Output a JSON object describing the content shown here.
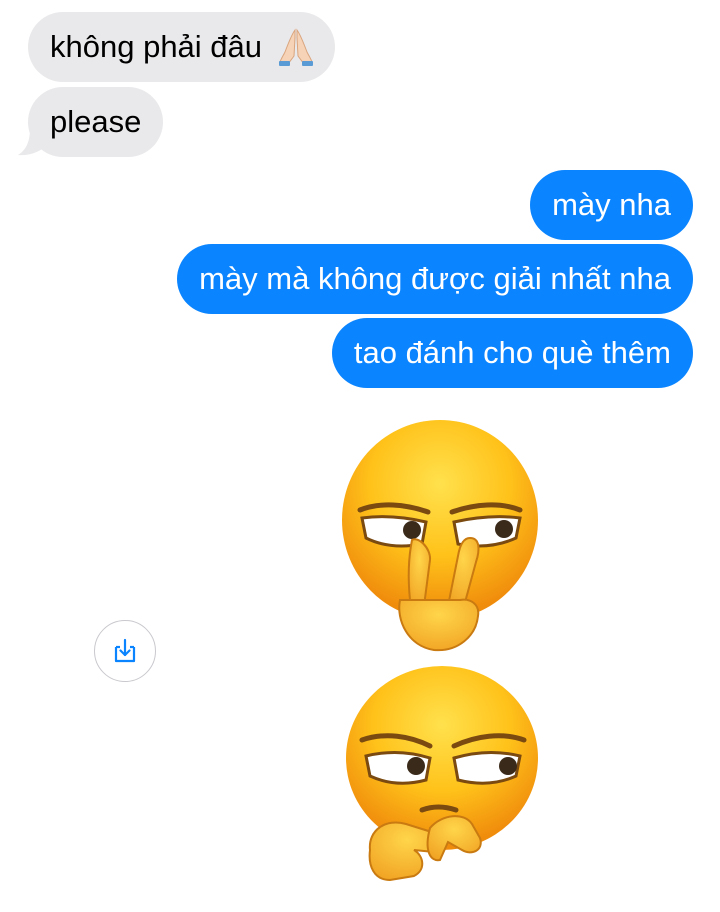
{
  "incoming_messages": [
    {
      "text": "không phải đâu",
      "emoji": "folded-hands"
    },
    {
      "text": "please"
    }
  ],
  "outgoing_messages": [
    {
      "text": "mày nha"
    },
    {
      "text": "mày mà không được giải nhất nha"
    },
    {
      "text": "tao đánh cho què thêm"
    }
  ],
  "sticker": {
    "type": "emoji-sticker",
    "faces": [
      "smug-face-peace-sign",
      "smug-face-pointing"
    ]
  },
  "icons": {
    "save": "download-icon"
  },
  "colors": {
    "outgoing_bubble": "#0a84ff",
    "incoming_bubble": "#e9e9eb",
    "emoji_yellow": "#ffcc22",
    "emoji_orange": "#f39c12",
    "icon_blue": "#0a84ff"
  }
}
